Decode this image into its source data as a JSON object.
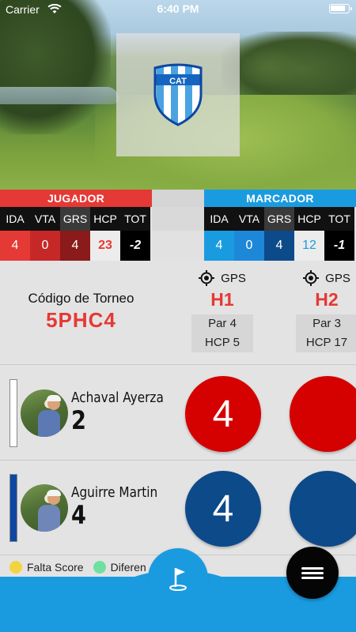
{
  "status_bar": {
    "carrier": "Carrier",
    "time": "6:40 PM"
  },
  "club": {
    "logo_text": "CAT"
  },
  "jugador": {
    "title": "JUGADOR",
    "color": "#e53935",
    "columns": [
      {
        "label": "IDA",
        "value": "4"
      },
      {
        "label": "VTA",
        "value": "0"
      },
      {
        "label": "GRS",
        "value": "4"
      },
      {
        "label": "HCP",
        "value": "23"
      },
      {
        "label": "TOT",
        "value": "-2"
      }
    ]
  },
  "marcador": {
    "title": "MARCADOR",
    "color": "#1a9be0",
    "columns": [
      {
        "label": "IDA",
        "value": "4"
      },
      {
        "label": "VTA",
        "value": "0"
      },
      {
        "label": "GRS",
        "value": "4"
      },
      {
        "label": "HCP",
        "value": "12"
      },
      {
        "label": "TOT",
        "value": "-1"
      }
    ]
  },
  "tournament": {
    "label": "Código de Torneo",
    "code": "5PHC4"
  },
  "holes": [
    {
      "gps": "GPS",
      "name": "H1",
      "par": "Par 4",
      "hcp": "HCP 5"
    },
    {
      "gps": "GPS",
      "name": "H2",
      "par": "Par 3",
      "hcp": "HCP 17"
    }
  ],
  "players": [
    {
      "name": "Achaval Ayerza",
      "handicap": "2",
      "score_h1": "4",
      "score_h2": "",
      "color": "#d50000",
      "bar_color": "#ffffff"
    },
    {
      "name": "Aguirre Martin",
      "handicap": "4",
      "score_h1": "4",
      "score_h2": "",
      "color": "#0d4a8a",
      "bar_color": "#0d47a1"
    }
  ],
  "legend": [
    {
      "label": "Falta Score",
      "color": "#f2d442"
    },
    {
      "label": "Diferen",
      "color": "#6ee0a0"
    }
  ]
}
